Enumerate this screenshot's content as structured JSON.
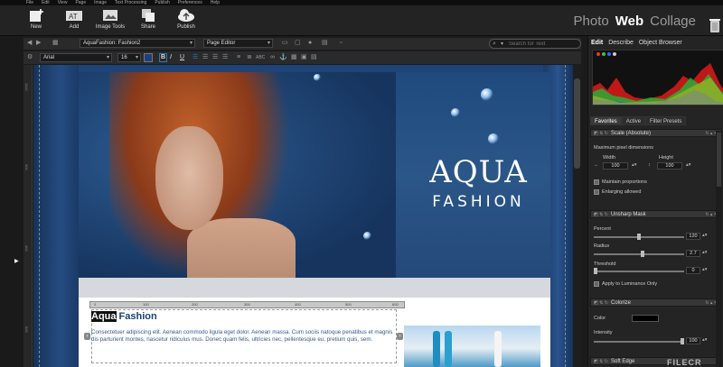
{
  "menubar": [
    "File",
    "Edit",
    "View",
    "Page",
    "Image",
    "Text Processing",
    "Publish",
    "Preferences",
    "Help"
  ],
  "toolbar": {
    "new_label": "New",
    "add_label": "Add",
    "image_tools_label": "Image Tools",
    "share_label": "Share",
    "publish_label": "Publish",
    "modes": {
      "photo": "Photo",
      "web": "Web",
      "collage": "Collage"
    }
  },
  "editor": {
    "document": "AquaFashion: Fashion2",
    "view_mode": "Page Editor",
    "search_placeholder": "Search for Text",
    "font": "Arial",
    "font_size": "16",
    "bold": "B",
    "italic": "I",
    "underline": "U"
  },
  "ruler_v": [
    "1100",
    "300",
    "400",
    "500"
  ],
  "ruler_h": [
    "0",
    "100",
    "200",
    "300",
    "400",
    "500",
    "600"
  ],
  "page": {
    "logo_title": "AQUA",
    "logo_sub": "FASHION",
    "heading_hl": "Aqua",
    "heading_rest": " Fashion",
    "body": "Consectetuer adipiscing elit. Aenean commodo ligula eget dolor. Aenean massa. Cum sociis natoque penatibus et magnis dis parturient montes, nascetur ridiculus mus. Donec quam felis, ultricies nec, pellentesque eu, pretium quis, sem."
  },
  "panel": {
    "tabs": [
      "Edit",
      "Describe",
      "Object Browser"
    ],
    "subtabs": [
      "Favorites",
      "Active",
      "Filter Presets"
    ],
    "scale": {
      "title": "Scale (Absolute)",
      "max_dim_label": "Maximum pixel dimensions",
      "width_label": "Width",
      "height_label": "Height",
      "width": "100",
      "height": "100",
      "maintain": "Maintain proportions",
      "enlarge": "Enlarging allowed"
    },
    "unsharp": {
      "title": "Unsharp Mask",
      "percent_label": "Percent",
      "percent": "120",
      "radius_label": "Radius",
      "radius": "2.7",
      "threshold_label": "Threshold",
      "threshold": "0",
      "luminance": "Apply to Luminance Only"
    },
    "colorize": {
      "title": "Colorize",
      "color_label": "Color",
      "intensity_label": "Intensity",
      "intensity": "100"
    },
    "softedge": {
      "title": "Soft Edge"
    }
  },
  "watermark": "FILECR",
  "colors": {
    "accent": "#1c3f75",
    "canvas": "#1e4376",
    "highlight": "#111111"
  }
}
